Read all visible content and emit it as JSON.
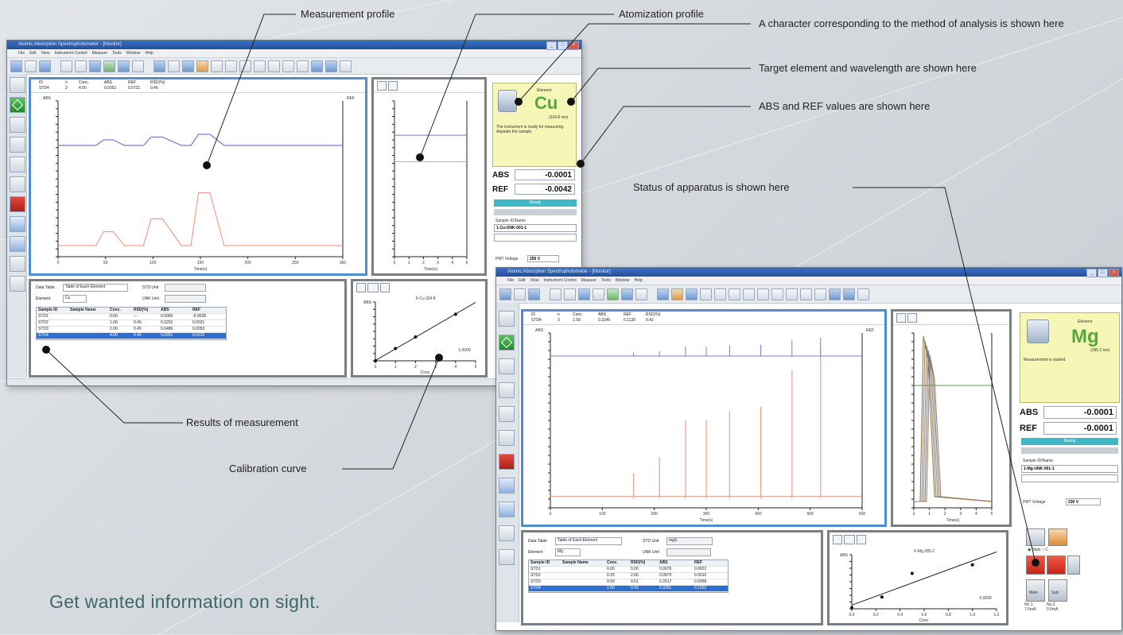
{
  "callouts": {
    "measurement_profile": "Measurement profile",
    "atomization_profile": "Atomization profile",
    "method_character": "A character corresponding to the method of analysis is shown here",
    "target_element": "Target element and wavelength are shown here",
    "abs_ref_values": "ABS and REF values are shown here",
    "status_apparatus": "Status of apparatus is shown here",
    "results": "Results of measurement",
    "calibration": "Calibration curve"
  },
  "tagline": "Get wanted information on sight.",
  "window1": {
    "title": "Atomic Absorption Spectrophotometer - [Monitor]",
    "menu": [
      "File",
      "Edit",
      "View",
      "Instrument Control",
      "Measure",
      "Tools",
      "Window",
      "Help"
    ],
    "info_headers": [
      "ID",
      "n",
      "Conc.",
      "ABS",
      "REF",
      "RSD(%)"
    ],
    "info_values": [
      "STD4",
      "2",
      "4.00",
      "0.0351",
      "0.0731",
      "0.45"
    ],
    "element": {
      "label": "Element",
      "symbol": "Cu",
      "wavelength": "(324.8 nm)",
      "message": "The instrument is ready for measuring. Aspirate the sample."
    },
    "abs": {
      "label": "ABS",
      "value": "-0.0001"
    },
    "ref": {
      "label": "REF",
      "value": "-0.0042"
    },
    "status": "Ready",
    "sample_id_label": "Sample ID/Name",
    "sample_id": "1-Cu-UNK-001-1",
    "pmt_label": "PMT Voltage",
    "pmt_value": "250 V",
    "profile_xlabel": "Time(s)",
    "profile_ylabel": "ABS",
    "profile_ylabel_right": "REF",
    "profile_xticks": [
      "0",
      "50",
      "100",
      "150",
      "200",
      "250",
      "300"
    ],
    "atom_xticks": [
      "0",
      "1",
      "2",
      "3",
      "4",
      "5"
    ],
    "table_label": "Data Table",
    "table_select": "Table of Each Element",
    "std_unit_label": "STD Unit",
    "element_label": "Element",
    "element_select": "Cu",
    "unk_unit_label": "UNK Unit",
    "table_headers": [
      "Sample ID",
      "Sample Name",
      "Conc.",
      "RSD(%)",
      "ABS",
      "REF"
    ],
    "table_rows": [
      [
        "STD1",
        "",
        "0.00",
        "---",
        "0.0000",
        "-0.0038"
      ],
      [
        "STD2",
        "",
        "1.00",
        "0.45",
        "0.0252",
        "0.0031"
      ],
      [
        "STD3",
        "",
        "2.00",
        "0.45",
        "0.0486",
        "0.0053"
      ],
      [
        "STD4",
        "",
        "4.00",
        "0.45",
        "0.0951",
        "0.0102"
      ]
    ],
    "cal_title": "F-Cu 324.8",
    "cal_ylabel": "ABS",
    "cal_xlabel": "Conc.",
    "cal_coef": "1.0000"
  },
  "window2": {
    "title": "Atomic Absorption Spectrophotometer - [Monitor]",
    "menu": [
      "File",
      "Edit",
      "View",
      "Instrument Control",
      "Measure",
      "Tools",
      "Window",
      "Help"
    ],
    "info_headers": [
      "ID",
      "n",
      "Conc.",
      "ABS",
      "REF",
      "RSD(%)"
    ],
    "info_values": [
      "STD4",
      "3",
      "1.00",
      "0.3246",
      "0.1139",
      "0.42"
    ],
    "element": {
      "label": "Element",
      "symbol": "Mg",
      "wavelength": "(285.2 nm)",
      "message": "Measurement is started."
    },
    "abs": {
      "label": "ABS",
      "value": "-0.0001"
    },
    "ref": {
      "label": "REF",
      "value": "-0.0001"
    },
    "status": "Ready",
    "sample_id_label": "Sample ID/Name",
    "sample_id": "1-Mg-UNK-001-1",
    "pmt_label": "PMT Voltage",
    "pmt_value": "230 V",
    "profile_xlabel": "Time(s)",
    "profile_ylabel": "ABS",
    "profile_ylabel_right": "REF",
    "profile_xticks": [
      "0",
      "100",
      "200",
      "300",
      "400",
      "500",
      "600"
    ],
    "atom_xticks": [
      "0",
      "1",
      "2",
      "3",
      "4",
      "5"
    ],
    "table_label": "Data Table",
    "table_select": "Table of Each Element",
    "std_unit_label": "STD Unit",
    "std_unit_value": "mg/L",
    "element_label": "Element",
    "element_select": "Mg",
    "unk_unit_label": "UNK Unit",
    "table_headers": [
      "Sample ID",
      "Sample Name",
      "Conc.",
      "RSD(%)",
      "ABS",
      "REF"
    ],
    "table_rows": [
      [
        "STD1",
        "",
        "0.00",
        "0.00",
        "0.0076",
        "0.0022"
      ],
      [
        "STD2",
        "",
        "0.25",
        "2.66",
        "0.0870",
        "0.0016"
      ],
      [
        "STD3",
        "",
        "0.50",
        "0.51",
        "0.2617",
        "0.0058"
      ],
      [
        "STD4",
        "",
        "1.00",
        "0.42",
        "0.3251",
        "0.1032"
      ]
    ],
    "cal_title": "F-Mg 285.2",
    "cal_ylabel": "ABS",
    "cal_xlabel": "Conc.",
    "cal_coef": "0.9999",
    "cal_xticks": [
      "0.0",
      "0.2",
      "0.4",
      "0.6",
      "0.8",
      "1.0",
      "1.2"
    ],
    "status_labels": {
      "gas": "Flow/C",
      "burn": "Burn",
      "temp": "Ta",
      "flame_on": "Flame",
      "ignite": "Ignite"
    },
    "lamp_labels": [
      "Main",
      "Sub"
    ],
    "lamp_info": [
      "No.1 7.5mA",
      "No.2 0.0mA"
    ]
  },
  "colors": {
    "blue_panel": "#4f8fd0",
    "elem_bg": "#f6f6b6",
    "elem_green": "#56a83a",
    "ready": "#3fb7c7",
    "abs_line": "#6f80c8",
    "ref_line": "#f0a088"
  },
  "chart_data": [
    {
      "type": "line",
      "title": "",
      "xlabel": "Time(s)",
      "ylabel": "ABS",
      "xlim": [
        0,
        300
      ],
      "ylim": [
        -0.02,
        0.26
      ],
      "series": [
        {
          "x": [
            0,
            40,
            48,
            58,
            70,
            90,
            98,
            110,
            130,
            140,
            148,
            160,
            175,
            300
          ],
          "values": [
            0.18,
            0.18,
            0.19,
            0.19,
            0.18,
            0.18,
            0.195,
            0.195,
            0.18,
            0.18,
            0.2,
            0.2,
            0.18,
            0.18
          ]
        },
        {
          "x": [
            0,
            40,
            48,
            58,
            70,
            90,
            98,
            110,
            130,
            140,
            148,
            160,
            175,
            300
          ],
          "values": [
            0.0,
            0.0,
            0.025,
            0.025,
            0.0,
            0.0,
            0.048,
            0.048,
            0.0,
            0.0,
            0.095,
            0.095,
            0.0,
            0.0
          ]
        }
      ]
    },
    {
      "type": "scatter",
      "title": "F-Cu 324.8",
      "xlabel": "Conc.",
      "ylabel": "ABS",
      "x": [
        0,
        1,
        2,
        4
      ],
      "values": [
        0.0,
        0.0252,
        0.0486,
        0.0951
      ],
      "xlim": [
        0,
        5
      ],
      "ylim": [
        0,
        0.12
      ]
    },
    {
      "type": "scatter",
      "title": "F-Mg 285.2",
      "xlabel": "Conc.",
      "ylabel": "ABS",
      "x": [
        0,
        0.25,
        0.5,
        1.0
      ],
      "values": [
        0.0076,
        0.087,
        0.2617,
        0.3251
      ],
      "xlim": [
        0,
        1.2
      ],
      "ylim": [
        0,
        0.4
      ]
    }
  ]
}
